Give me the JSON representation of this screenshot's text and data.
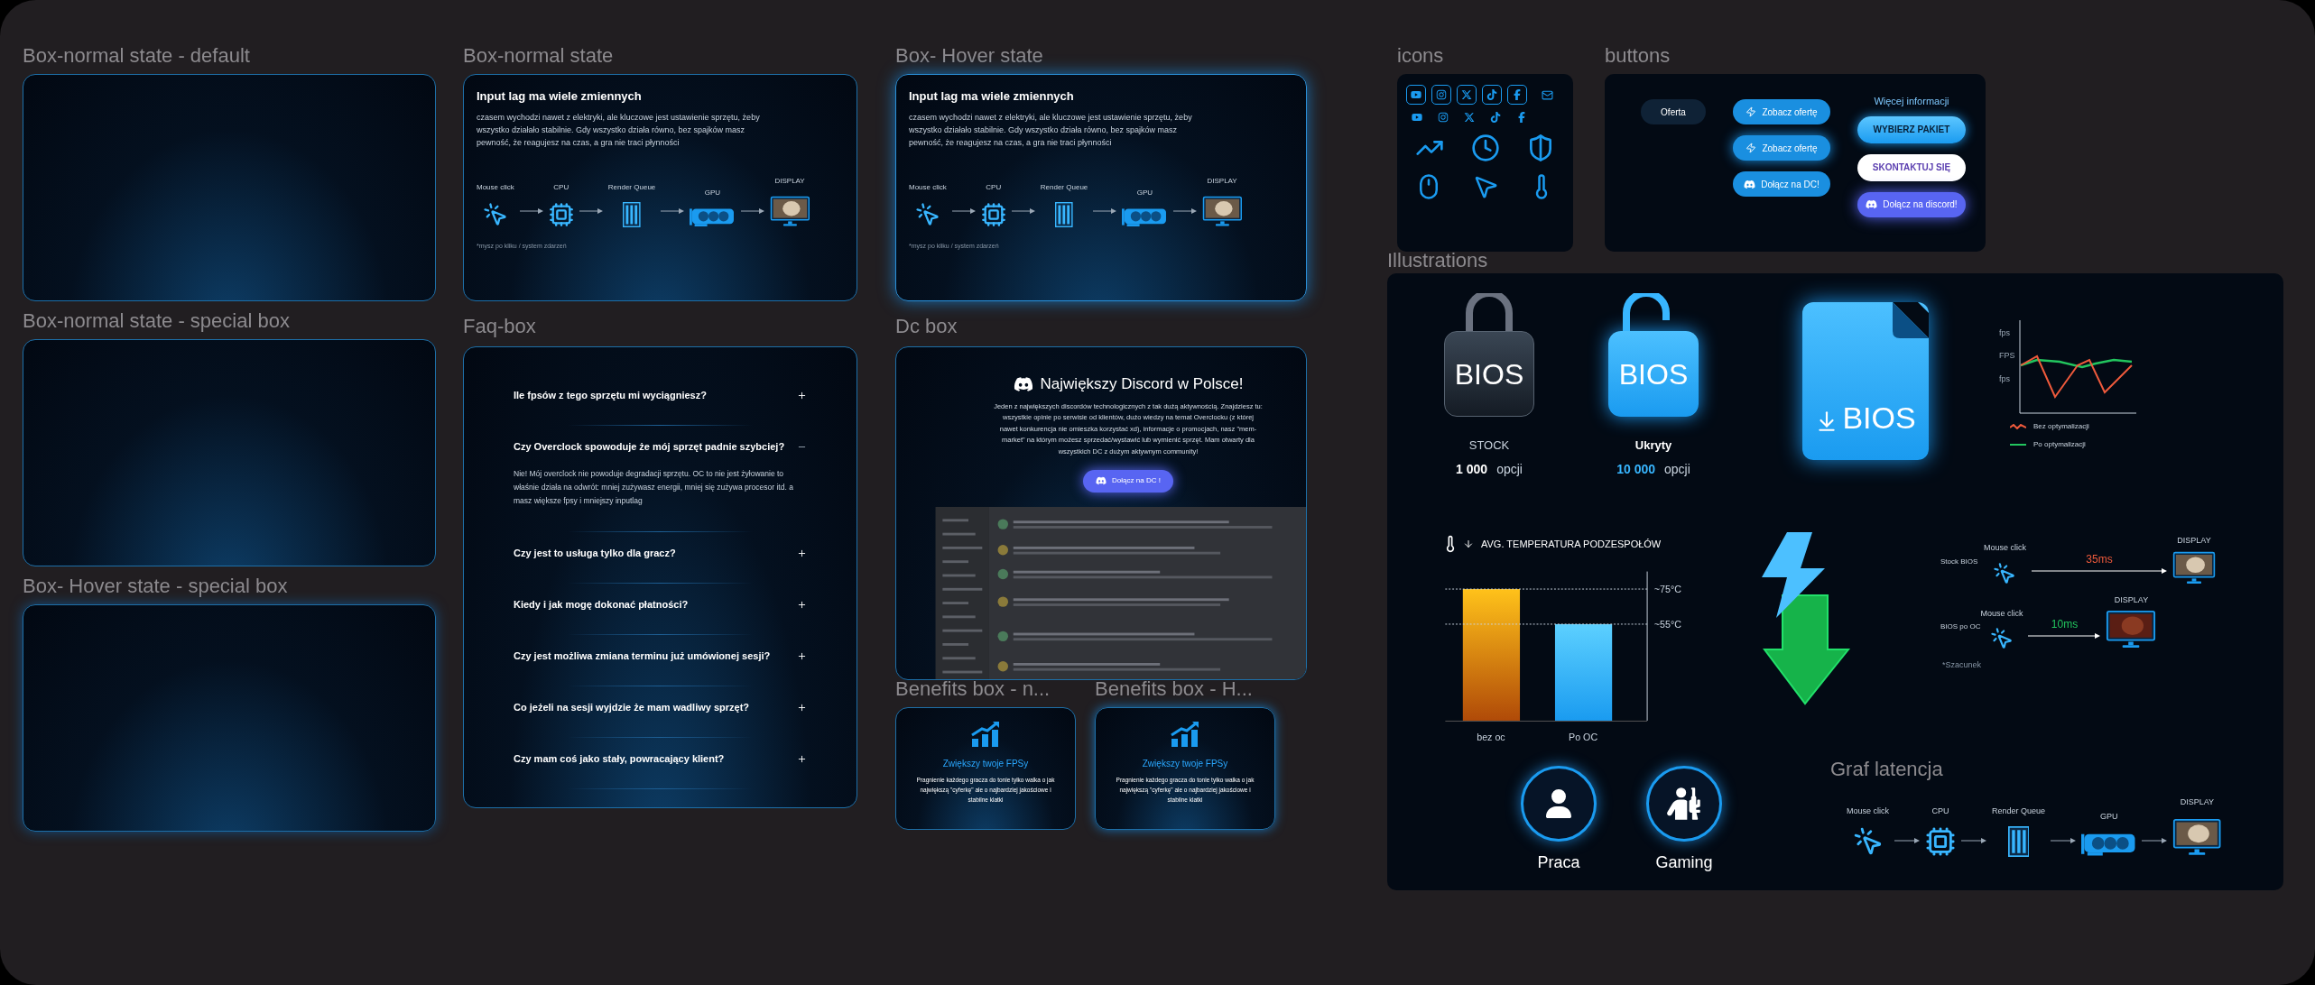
{
  "box_default": {
    "label": "Box-normal state - default"
  },
  "box_special": {
    "label": "Box-normal state - special box"
  },
  "box_hover_special": {
    "label": "Box- Hover state - special box"
  },
  "latency_boxes": [
    {
      "label": "Box-normal state",
      "hover": false,
      "title": "Input lag ma wiele zmiennych",
      "text": "czasem wychodzi nawet z elektryki, ale kluczowe jest ustawienie sprzętu, żeby wszystko działało stabilnie. Gdy wszystko działa równo, bez spajków masz pewność, że reagujesz na czas, a gra nie traci płynności",
      "steps": [
        {
          "kind": "mouse",
          "label": "Mouse click"
        },
        {
          "kind": "cpu",
          "label": "CPU"
        },
        {
          "kind": "queue",
          "label": "Render Queue"
        },
        {
          "kind": "gpu",
          "label": "GPU"
        },
        {
          "kind": "display",
          "label": "DISPLAY"
        }
      ],
      "note": "*mysz po kliku / system zdarzeń"
    },
    {
      "label": "Box- Hover state",
      "hover": true,
      "title": "Input lag ma wiele zmiennych",
      "text": "czasem wychodzi nawet z elektryki, ale kluczowe jest ustawienie sprzętu, żeby wszystko działało stabilnie. Gdy wszystko działa równo, bez spajków masz pewność, że reagujesz na czas, a gra nie traci płynności",
      "steps": [
        {
          "kind": "mouse",
          "label": "Mouse click"
        },
        {
          "kind": "cpu",
          "label": "CPU"
        },
        {
          "kind": "queue",
          "label": "Render Queue"
        },
        {
          "kind": "gpu",
          "label": "GPU"
        },
        {
          "kind": "display",
          "label": "DISPLAY"
        }
      ],
      "note": "*mysz po kliku / system zdarzeń"
    }
  ],
  "faq": {
    "label": "Faq-box",
    "items": [
      {
        "question": "Ile fpsów z tego sprzętu mi wyciągniesz?",
        "expanded": false
      },
      {
        "question": "Czy Overclock spowoduje że mój sprzęt padnie szybciej?",
        "expanded": true,
        "answer": "Nie! Mój overclock nie powoduje degradacji sprzętu. OC to nie jest żyłowanie to właśnie działa na odwrót: mniej zużywasz energii, mniej się zużywa procesor itd. a masz większe fpsy i mniejszy inputlag"
      },
      {
        "question": "Czy jest to usługa tylko dla gracz?",
        "expanded": false
      },
      {
        "question": "Kiedy i jak mogę dokonać płatności?",
        "expanded": false
      },
      {
        "question": "Czy jest możliwa zmiana terminu już umówionej sesji?",
        "expanded": false
      },
      {
        "question": "Co jeżeli na sesji wyjdzie że mam wadliwy sprzęt?",
        "expanded": false
      },
      {
        "question": "Czy mam coś jako stały, powracający klient?",
        "expanded": false
      }
    ]
  },
  "dc_box": {
    "label": "Dc box",
    "title": "Największy Discord w Polsce!",
    "text": "Jeden z największych discordów technologicznych z tak dużą aktywnością. Znajdziesz tu: wszystkie opinie po serwisie od klientów, dużo wiedzy na temat Overclocku (z której nawet konkurencja nie omieszka korzystać xd), informacje o promocjach, nasz \"mem-market\" na którym możesz sprzedać/wystawić lub wymienić sprzęt. Mam otwarty dla wszystkich DC z dużym aktywnym community!",
    "button": "Dołącz na DC !"
  },
  "benefits": [
    {
      "label": "Benefits box - n...",
      "hover": false,
      "title": "Zwiększy twoje FPSy",
      "text": "Pragnienie każdego gracza do tonie tylko walka o jak największą \"cyferkę\" ale o najbardziej jakościowe i stabilne klatki"
    },
    {
      "label": "Benefits box - H...",
      "hover": true,
      "title": "Zwiększy twoje FPSy",
      "text": "Pragnienie każdego gracza do tonie tylko walka o jak największą \"cyferkę\" ale o najbardziej jakościowe i stabilne klatki"
    }
  ],
  "icons": {
    "label": "icons"
  },
  "buttons": {
    "label": "buttons",
    "groups": [
      {
        "items": [
          {
            "kind": "dark",
            "label": "Oferta"
          }
        ]
      },
      {
        "items": [
          {
            "kind": "blue",
            "label": "Zobacz ofertę"
          },
          {
            "kind": "blue-glow",
            "label": "Zobacz ofertę"
          },
          {
            "kind": "blue-discord",
            "label": "Dołącz na DC!"
          }
        ]
      },
      {
        "heading": "Więcej informacji",
        "items": [
          {
            "kind": "primary",
            "label": "WYBIERZ PAKIET"
          },
          {
            "kind": "white",
            "label": "SKONTAKTUJ SIĘ"
          },
          {
            "kind": "discord",
            "label": "Dołącz na discord!"
          }
        ]
      }
    ]
  },
  "illustrations": {
    "label": "Illustrations",
    "bios": [
      {
        "kind": "locked",
        "badge": "BIOS",
        "name": "STOCK",
        "count": "1 000",
        "unit": "opcji"
      },
      {
        "kind": "unlocked",
        "badge": "BIOS",
        "name": "Ukryty",
        "count": "10 000",
        "unit": "opcji"
      }
    ],
    "bios_file": {
      "label": "BIOS"
    },
    "fps_chart": {
      "axis_labels": [
        "fps",
        "FPS",
        "fps"
      ],
      "legend": [
        {
          "label": "Bez optymalizacji",
          "color": "#ef5a3c"
        },
        {
          "label": "Po optymalizacji",
          "color": "#22c55e"
        }
      ]
    },
    "temperature": {
      "title": "AVG. TEMPERATURA PODZESPOŁÓW",
      "chart_data": {
        "type": "bar",
        "categories": [
          "bez oc",
          "Po OC"
        ],
        "values": [
          75,
          55
        ],
        "ylim": [
          0,
          85
        ],
        "yticks": [
          {
            "value": 75,
            "label": "~75°C"
          },
          {
            "value": 55,
            "label": "~55°C"
          }
        ]
      }
    },
    "latency_compare": {
      "rows": [
        {
          "label": "Stock BIOS",
          "step": "Mouse click",
          "time": "35ms",
          "color": "#ef5a3c",
          "display": "DISPLAY"
        },
        {
          "label": "BIOS po OC",
          "step": "Mouse click",
          "time": "10ms",
          "color": "#22c55e",
          "display": "DISPLAY"
        }
      ],
      "note": "*Szacunek"
    },
    "modes": [
      {
        "kind": "user",
        "label": "Praca"
      },
      {
        "kind": "gamer",
        "label": "Gaming"
      }
    ],
    "latency_graph": {
      "label": "Graf latencja",
      "steps": [
        {
          "kind": "mouse",
          "label": "Mouse click"
        },
        {
          "kind": "cpu",
          "label": "CPU"
        },
        {
          "kind": "queue",
          "label": "Render Queue"
        },
        {
          "kind": "gpu",
          "label": "GPU"
        },
        {
          "kind": "display",
          "label": "DISPLAY"
        }
      ]
    }
  }
}
